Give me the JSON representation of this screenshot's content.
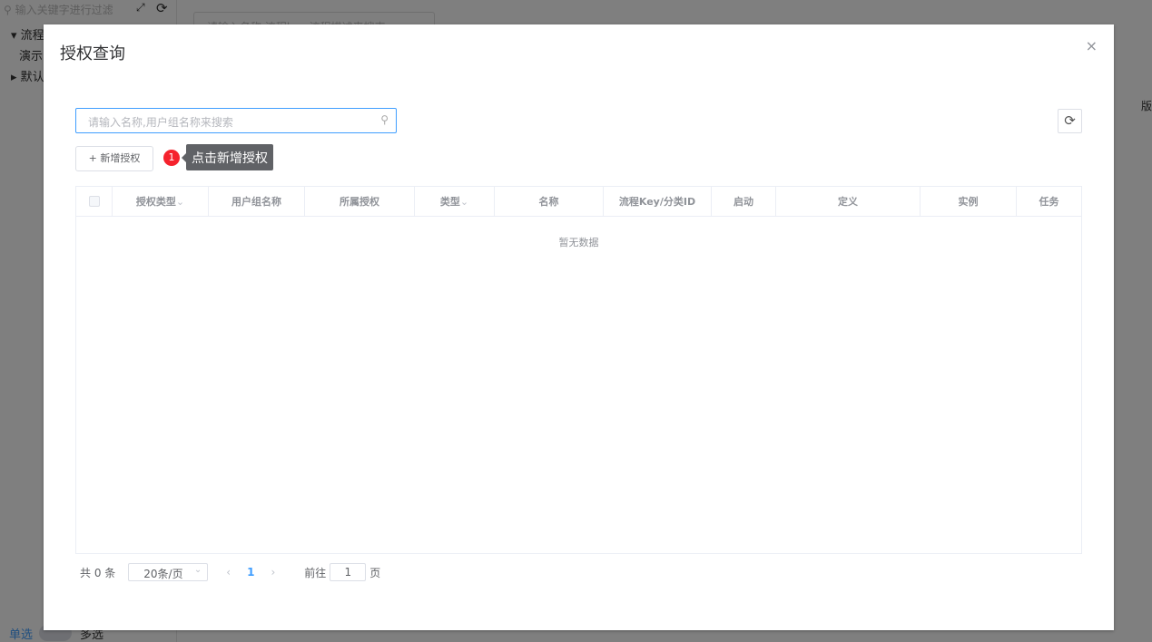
{
  "background": {
    "filter_placeholder": "输入关键字进行过滤",
    "tree": [
      "流程分",
      "演示",
      "默认"
    ],
    "search_placeholder": "请输入名称,流程key,流程描述来搜索",
    "header_partial": "版",
    "single": "单选",
    "multi": "多选"
  },
  "dialog": {
    "title": "授权查询",
    "close": "×",
    "search_placeholder": "请输入名称,用户组名称来搜索",
    "add_button": "+ 新增授权",
    "badge": "1",
    "tooltip": "点击新增授权",
    "columns": [
      "授权类型",
      "用户组名称",
      "所属授权",
      "类型",
      "名称",
      "流程Key/分类ID",
      "启动",
      "定义",
      "实例",
      "任务"
    ],
    "empty": "暂无数据",
    "pagination": {
      "total": "共 0 条",
      "page_size": "20条/页",
      "current": "1",
      "goto_label": "前往",
      "goto_value": "1",
      "page_suffix": "页"
    }
  }
}
